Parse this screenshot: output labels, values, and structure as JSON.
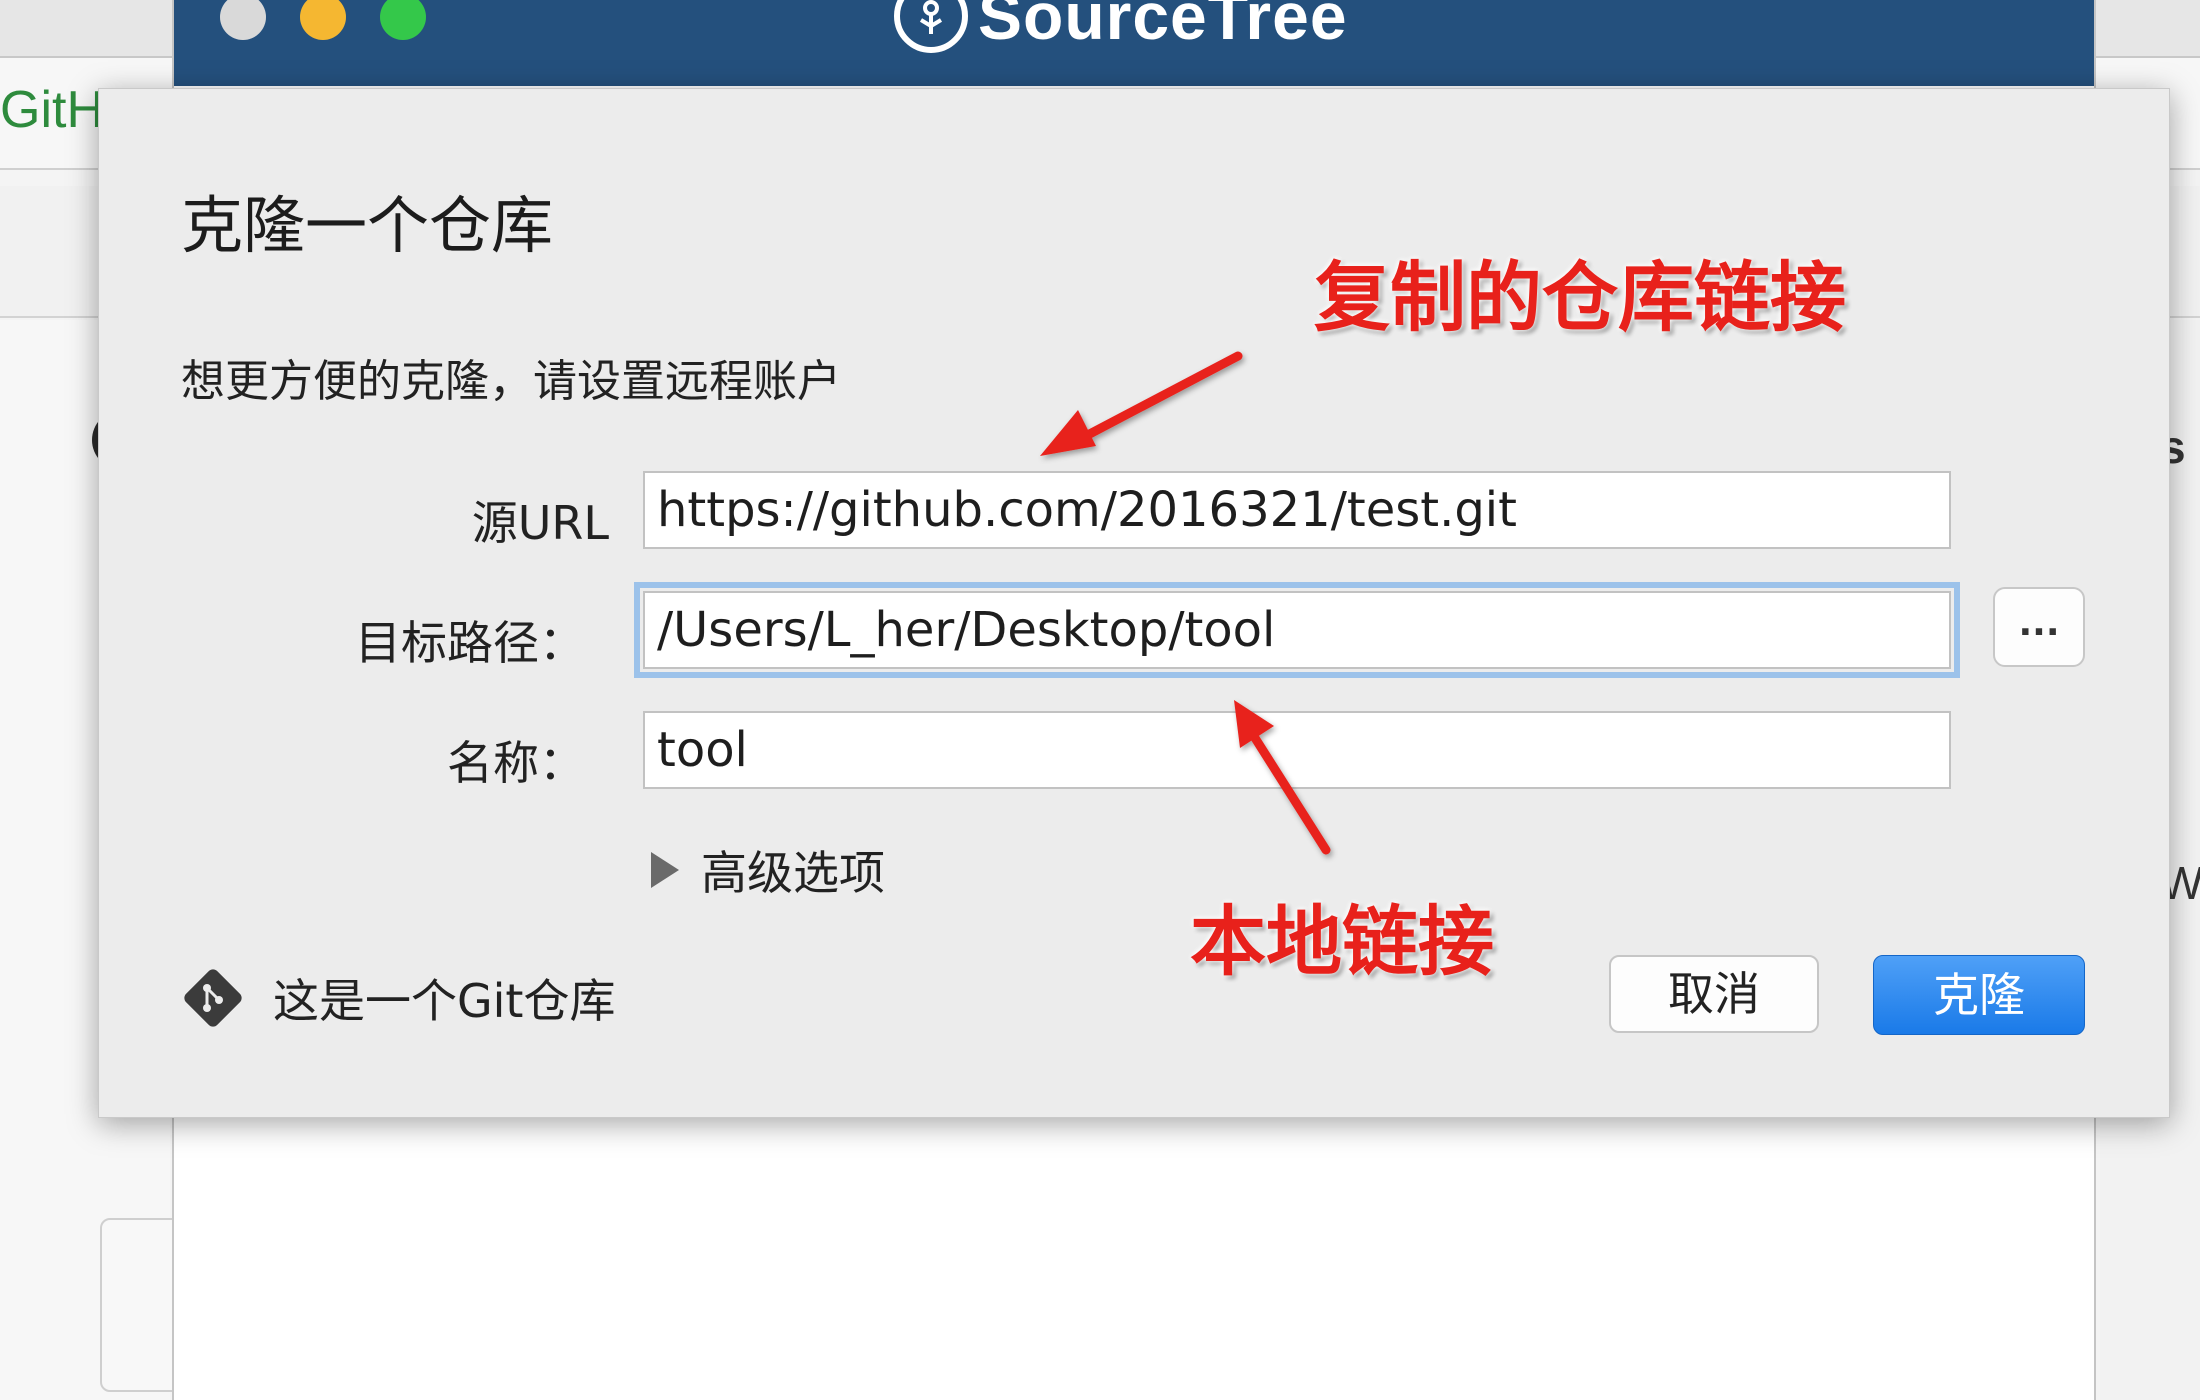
{
  "background": {
    "github_text": "GitH",
    "right_letter_top": "s",
    "right_letter_bottom": "W"
  },
  "app": {
    "name": "SourceTree"
  },
  "dialog": {
    "title": "克隆一个仓库",
    "subtitle": "想更方便的克隆，请设置远程账户",
    "source_url_label": "源URL",
    "source_url_value": "https://github.com/2016321/test.git",
    "dest_path_label": "目标路径：",
    "dest_path_value": "/Users/L_her/Desktop/tool",
    "browse_label": "...",
    "name_label": "名称：",
    "name_value": "tool",
    "advanced_label": "高级选项",
    "repo_type_label": "这是一个Git仓库",
    "cancel_label": "取消",
    "clone_label": "克隆"
  },
  "annotations": {
    "top_text": "复制的仓库链接",
    "bottom_text": "本地链接",
    "color": "#e8211b"
  },
  "colors": {
    "titlebar": "#24507d",
    "accent_button": "#1a7ae8",
    "focus_ring": "#9cc2ea"
  }
}
